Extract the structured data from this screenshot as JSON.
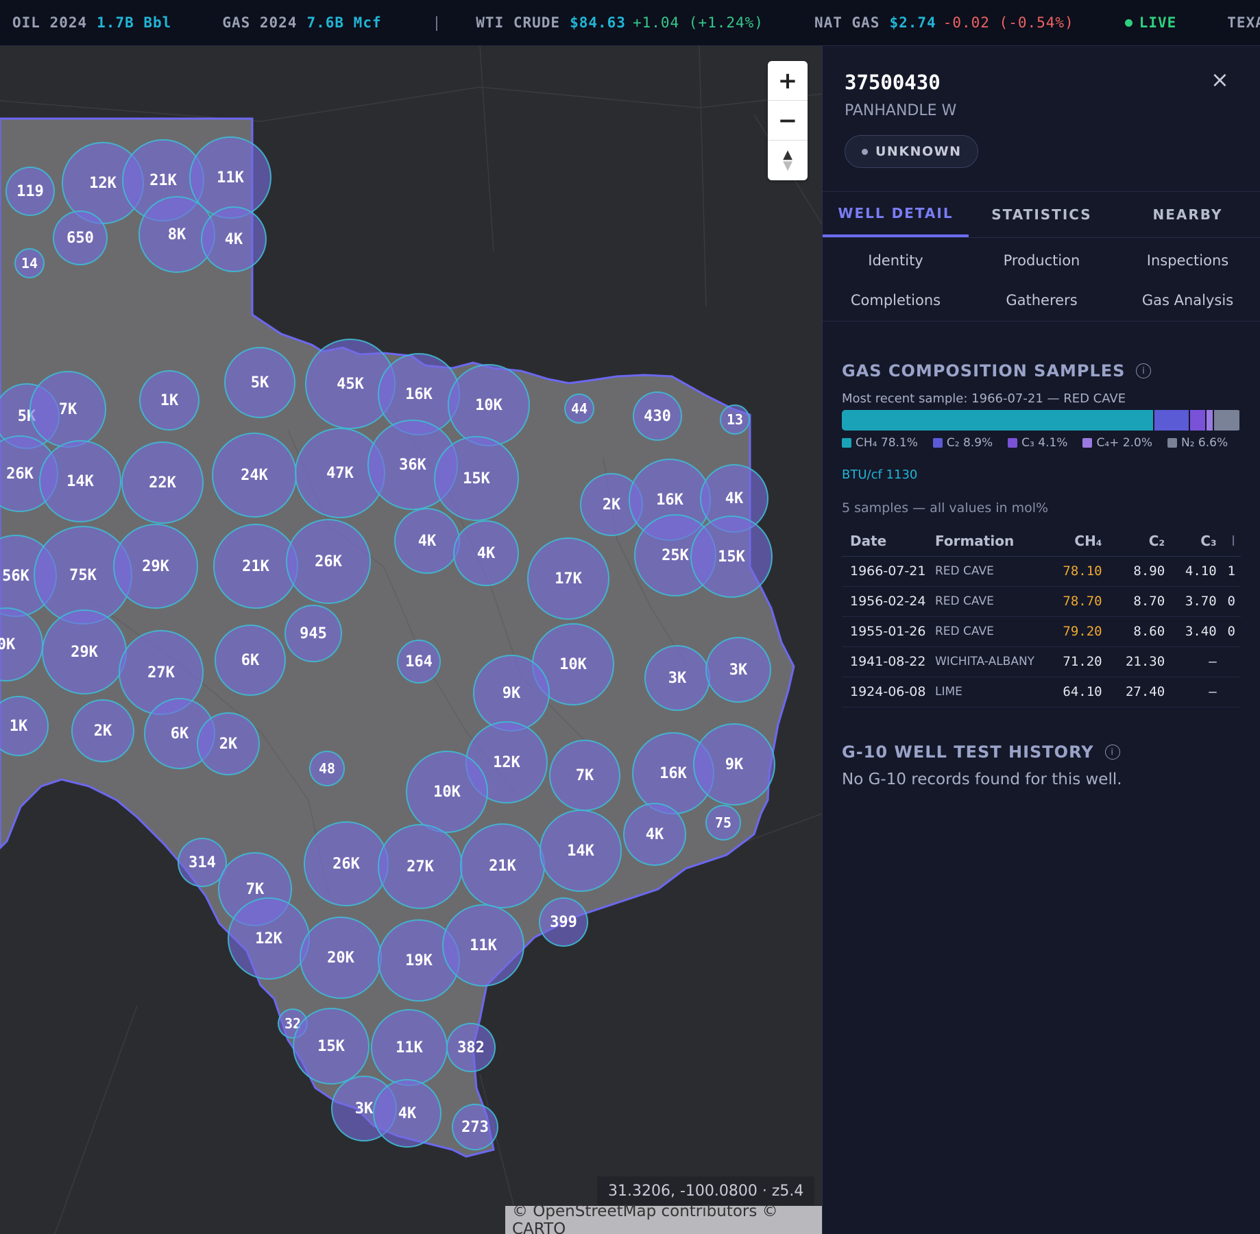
{
  "ticker": {
    "items": [
      {
        "label": "OIL 2024",
        "value": "1.7B Bbl"
      },
      {
        "label": "GAS 2024",
        "value": "7.6B Mcf"
      },
      {
        "label": "WTI CRUDE",
        "value": "$84.63",
        "change": "+1.04 (+1.24%)"
      },
      {
        "label": "NAT GAS",
        "value": "$2.74",
        "change": "-0.02 (-0.54%)"
      }
    ],
    "separator": "|",
    "live": "LIVE",
    "trailing": "TEXAS WEL"
  },
  "map": {
    "zoom_in": "+",
    "zoom_out": "−",
    "coordinates": "31.3206, -100.0800 · z5.4",
    "attribution": "© OpenStreetMap contributors © CARTO",
    "clusters": [
      "119",
      "12K",
      "21K",
      "11K",
      "650",
      "8K",
      "4K",
      "14",
      "5K",
      "7K",
      "1K",
      "5K",
      "45K",
      "16K",
      "10K",
      "44",
      "430",
      "13",
      "26K",
      "14K",
      "22K",
      "24K",
      "47K",
      "36K",
      "15K",
      "2K",
      "16K",
      "4K",
      "56K",
      "75K",
      "29K",
      "21K",
      "26K",
      "4K",
      "4K",
      "17K",
      "25K",
      "15K",
      "0K",
      "29K",
      "27K",
      "6K",
      "945",
      "164",
      "10K",
      "9K",
      "3K",
      "3K",
      "1K",
      "2K",
      "6K",
      "2K",
      "48",
      "12K",
      "10K",
      "7K",
      "16K",
      "9K",
      "75",
      "4K",
      "314",
      "7K",
      "26K",
      "27K",
      "21K",
      "14K",
      "399",
      "12K",
      "20K",
      "19K",
      "11K",
      "32",
      "15K",
      "11K",
      "382",
      "3K",
      "4K",
      "273"
    ]
  },
  "panel": {
    "well_id": "37500430",
    "field_name": "PANHANDLE W",
    "status": "UNKNOWN",
    "close_icon": "×",
    "tabs": [
      "WELL DETAIL",
      "STATISTICS",
      "NEARBY"
    ],
    "subtabs": [
      "Identity",
      "Production",
      "Inspections",
      "Completions",
      "Gatherers",
      "Gas Analysis"
    ],
    "gas_section": {
      "title": "GAS COMPOSITION SAMPLES",
      "info_icon": "i",
      "recent": "Most recent sample: 1966-07-21 — RED CAVE",
      "composition": [
        {
          "label": "CH₄ 78.1%",
          "pct": 78.1,
          "color": "#1aa3b8"
        },
        {
          "label": "C₂ 8.9%",
          "pct": 8.9,
          "color": "#5b5bd6"
        },
        {
          "label": "C₃ 4.1%",
          "pct": 4.1,
          "color": "#7a52d8"
        },
        {
          "label": "C₄+ 2.0%",
          "pct": 2.0,
          "color": "#9a7ae0"
        },
        {
          "label": "N₂ 6.6%",
          "pct": 6.6,
          "color": "#7a8298"
        }
      ],
      "btu": "BTU/cf 1130",
      "samples_note": "5 samples — all values in mol%",
      "columns": [
        "Date",
        "Formation",
        "CH₄",
        "C₂",
        "C₃",
        "I"
      ],
      "rows": [
        {
          "date": "1966-07-21",
          "formation": "RED CAVE",
          "ch4": "78.10",
          "c2": "8.90",
          "c3": "4.10",
          "c4": "1",
          "hl": true
        },
        {
          "date": "1956-02-24",
          "formation": "RED CAVE",
          "ch4": "78.70",
          "c2": "8.70",
          "c3": "3.70",
          "c4": "0",
          "hl": true
        },
        {
          "date": "1955-01-26",
          "formation": "RED CAVE",
          "ch4": "79.20",
          "c2": "8.60",
          "c3": "3.40",
          "c4": "0",
          "hl": true
        },
        {
          "date": "1941-08-22",
          "formation": "WICHITA-ALBANY",
          "ch4": "71.20",
          "c2": "21.30",
          "c3": "—",
          "c4": "",
          "hl": false
        },
        {
          "date": "1924-06-08",
          "formation": "LIME",
          "ch4": "64.10",
          "c2": "27.40",
          "c3": "—",
          "c4": "",
          "hl": false
        }
      ]
    },
    "g10_section": {
      "title": "G-10 WELL TEST HISTORY",
      "info_icon": "i",
      "empty": "No G-10 records found for this well."
    }
  }
}
